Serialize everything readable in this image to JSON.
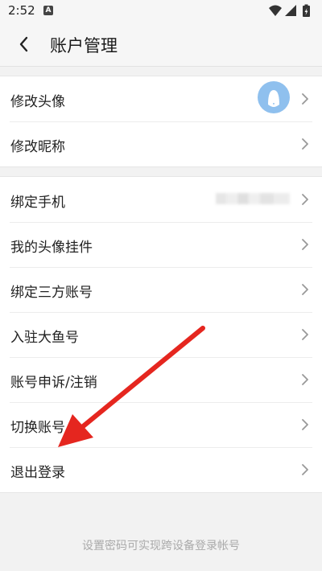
{
  "status_bar": {
    "time": "2:52",
    "notification_icon": "A"
  },
  "header": {
    "title": "账户管理",
    "back_icon": "chevron-left-icon"
  },
  "group1": {
    "items": [
      {
        "label": "修改头像",
        "trailing": "avatar"
      },
      {
        "label": "修改昵称"
      }
    ]
  },
  "group2": {
    "items": [
      {
        "label": "绑定手机",
        "trailing": "redacted-value"
      },
      {
        "label": "我的头像挂件"
      },
      {
        "label": "绑定三方账号"
      },
      {
        "label": "入驻大鱼号"
      },
      {
        "label": "账号申诉/注销"
      },
      {
        "label": "切换账号"
      },
      {
        "label": "退出登录"
      }
    ]
  },
  "footer": {
    "hint": "设置密码可实现跨设备登录帐号"
  },
  "colors": {
    "annotation_arrow": "#e5261f",
    "avatar": "#8fc0ee"
  }
}
